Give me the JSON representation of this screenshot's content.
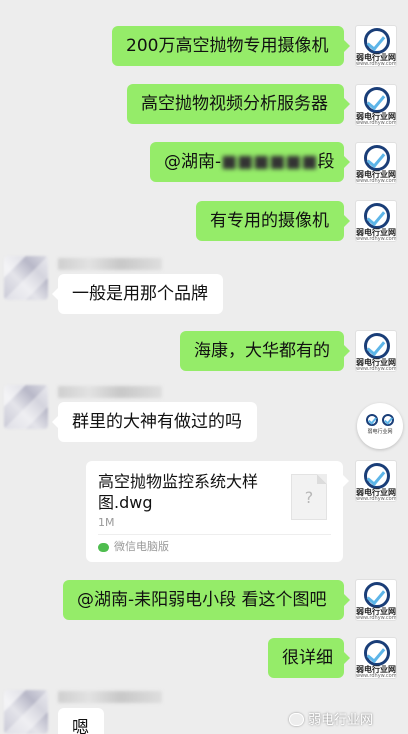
{
  "right_avatar": {
    "brand": "弱电行业网",
    "url": "www.rdhyw.com"
  },
  "messages": [
    {
      "text": "200万高空抛物专用摄像机"
    },
    {
      "text": "高空抛物视频分析服务器"
    },
    {
      "text_visible": "@湖南-",
      "text_tail": "段"
    },
    {
      "text": "有专用的摄像机"
    },
    {
      "text": "一般是用那个品牌"
    },
    {
      "text": "海康，大华都有的"
    },
    {
      "text": "群里的大神有做过的吗"
    },
    {
      "text": "@湖南-耒阳弱电小段 看这个图吧"
    },
    {
      "text": "很详细"
    },
    {
      "text": "嗯"
    }
  ],
  "file": {
    "name": "高空抛物监控系统大样图.dwg",
    "size": "1M",
    "source": "微信电脑版",
    "icon": "unknown-file-icon",
    "icon_glyph": "?"
  },
  "floating_badge": {
    "text": "弱电行业网"
  },
  "watermark": {
    "text": "弱电行业网"
  },
  "colors": {
    "right_bubble": "#95ec69",
    "left_bubble": "#ffffff",
    "background": "#ededed"
  }
}
